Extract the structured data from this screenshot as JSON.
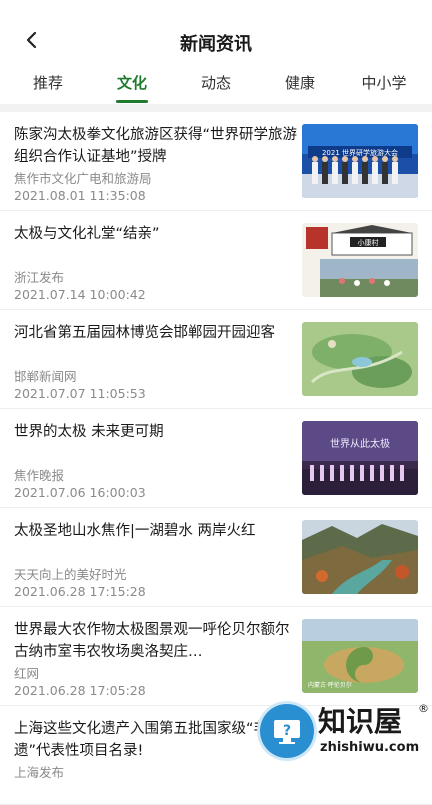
{
  "header": {
    "title": "新闻资讯",
    "back_icon": "arrow-left-icon"
  },
  "tabs": [
    {
      "label": "推荐",
      "active": false
    },
    {
      "label": "文化",
      "active": true
    },
    {
      "label": "动态",
      "active": false
    },
    {
      "label": "健康",
      "active": false
    },
    {
      "label": "中小学",
      "active": false
    }
  ],
  "accent_color": "#1f7a2e",
  "news": [
    {
      "title": "陈家沟太极拳文化旅游区获得“世界研学旅游组织合作认证基地”授牌",
      "source": "焦作市文化广电和旅游局",
      "date": "2021.08.01 11:35:08"
    },
    {
      "title": "太极与文化礼堂“结亲”",
      "source": "浙江发布",
      "date": "2021.07.14 10:00:42"
    },
    {
      "title": "河北省第五届园林博览会邯郸园开园迎客",
      "source": "邯郸新闻网",
      "date": "2021.07.07 11:05:53"
    },
    {
      "title": "世界的太极 未来更可期",
      "source": "焦作晚报",
      "date": "2021.07.06 16:00:03"
    },
    {
      "title": "太极圣地山水焦作|一湖碧水 两岸火红",
      "source": "天天向上的美好时光",
      "date": "2021.06.28 17:15:28"
    },
    {
      "title": "世界最大农作物太极图景观一呼伦贝尔额尔古纳市室韦农牧场奥洛契庄…",
      "source": "红网",
      "date": "2021.06.28 17:05:28"
    },
    {
      "title": "上海这些文化遗产入围第五批国家级“非遗”代表性项目名录!",
      "source": "上海发布",
      "date": ""
    }
  ],
  "thumb_texts": {
    "t1_banner": "2021 世界研学旅游大会",
    "t2_sign": "小康村",
    "t4_banner": "世界从此太极",
    "t6_caption": "内蒙古·呼伦贝尔"
  },
  "watermark": {
    "name": "知识屋",
    "url": "zhishiwu.com",
    "reg": "®"
  }
}
